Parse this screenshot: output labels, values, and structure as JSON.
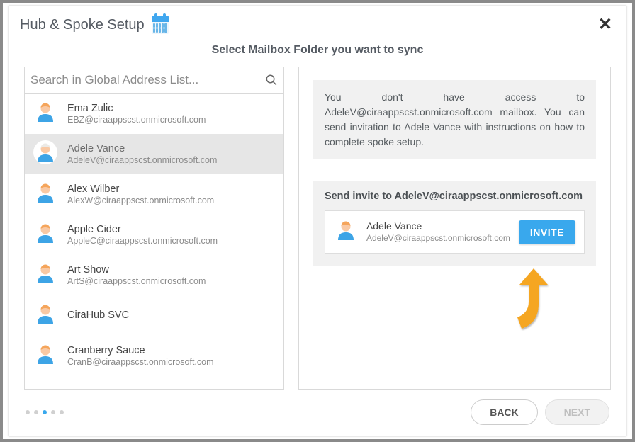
{
  "header": {
    "title": "Hub & Spoke Setup"
  },
  "subtitle": "Select Mailbox Folder you want to sync",
  "search": {
    "placeholder": "Search in Global Address List..."
  },
  "contacts": [
    {
      "name": "Ema Zulic",
      "email": "EBZ@ciraappscst.onmicrosoft.com",
      "hair": "#f5a55b",
      "selected": false
    },
    {
      "name": "Adele Vance",
      "email": "AdeleV@ciraappscst.onmicrosoft.com",
      "hair": "#eceae6",
      "selected": true
    },
    {
      "name": "Alex Wilber",
      "email": "AlexW@ciraappscst.onmicrosoft.com",
      "hair": "#f5a55b",
      "selected": false
    },
    {
      "name": "Apple Cider",
      "email": "AppleC@ciraappscst.onmicrosoft.com",
      "hair": "#f5a55b",
      "selected": false
    },
    {
      "name": "Art Show",
      "email": "ArtS@ciraappscst.onmicrosoft.com",
      "hair": "#f5a55b",
      "selected": false
    },
    {
      "name": "CiraHub SVC",
      "email": "",
      "hair": "#f5a55b",
      "selected": false
    },
    {
      "name": "Cranberry Sauce",
      "email": "CranB@ciraappscst.onmicrosoft.com",
      "hair": "#f5a55b",
      "selected": false
    }
  ],
  "message": "You don't have access to AdeleV@ciraappscst.onmicrosoft.com mailbox. You can send invitation to Adele Vance with instructions on how to complete spoke setup.",
  "invite": {
    "title": "Send invite to AdeleV@ciraappscst.onmicrosoft.com",
    "card": {
      "name": "Adele Vance",
      "email": "AdeleV@ciraappscst.onmicrosoft.com",
      "hair": "#f5a55b"
    },
    "button_label": "INVITE"
  },
  "footer": {
    "steps": 5,
    "active_step": 2,
    "back_label": "BACK",
    "next_label": "NEXT",
    "next_enabled": false
  },
  "colors": {
    "accent": "#39a8ed",
    "arrow": "#f5a623"
  }
}
